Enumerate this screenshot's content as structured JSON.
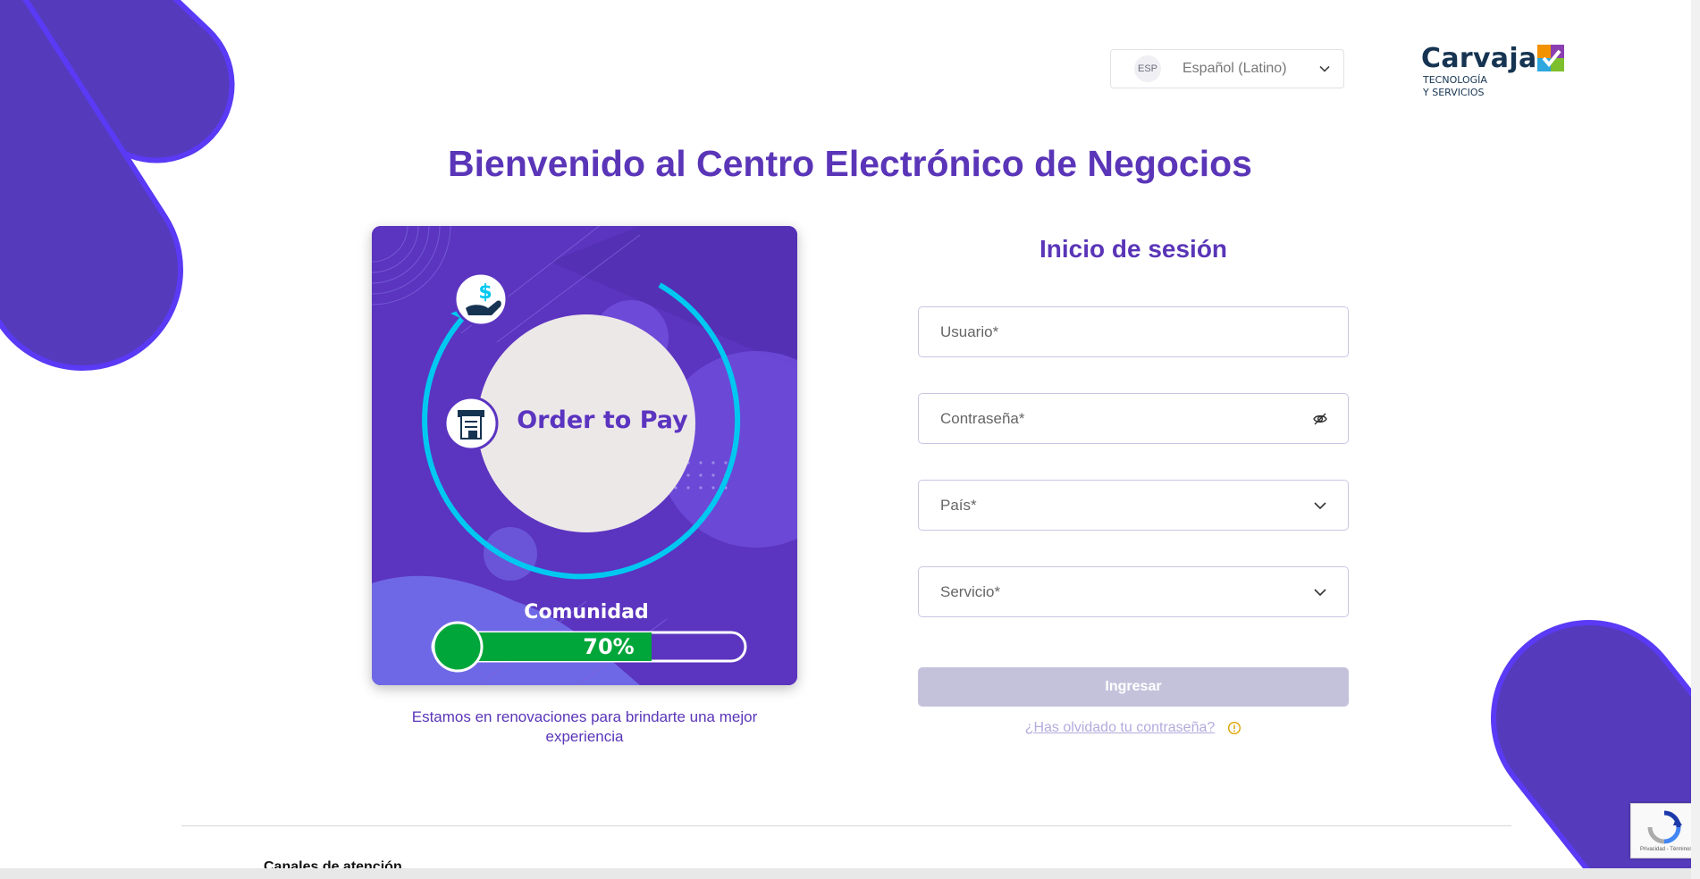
{
  "language": {
    "code": "ESP",
    "label": "Español (Latino)"
  },
  "logo": {
    "name": "Carvajal",
    "line1": "TECNOLOGÍA",
    "line2": "Y SERVICIOS"
  },
  "header": {
    "title": "Bienvenido al Centro Electrónico de Negocios"
  },
  "promo": {
    "product": "Order to Pay",
    "community_label": "Comunidad",
    "progress_value": 70,
    "progress_text": "70%",
    "caption": "Estamos en renovaciones para brindarte una mejor experiencia"
  },
  "login": {
    "title": "Inicio de sesión",
    "username_placeholder": "Usuario*",
    "password_placeholder": "Contraseña*",
    "country_label": "País*",
    "service_label": "Servicio*",
    "submit_label": "Ingresar",
    "forgot_label": "¿Has olvidado tu contraseña?"
  },
  "footer": {
    "title": "Canales de atención"
  },
  "recaptcha": {
    "links": "Privacidad - Términos"
  },
  "colors": {
    "brand": "#5a35b8",
    "accent": "#00c8f0",
    "progress": "#00a63a",
    "button_disabled": "#c4c2db"
  }
}
